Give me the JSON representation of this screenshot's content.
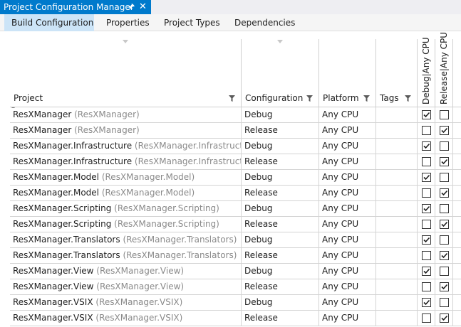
{
  "window": {
    "title": "Project Configuration Manager",
    "pin_icon": "pin-icon",
    "close_icon": "close-icon"
  },
  "tabs": [
    {
      "label": "Build Configuration",
      "active": true
    },
    {
      "label": "Properties",
      "active": false
    },
    {
      "label": "Project Types",
      "active": false
    },
    {
      "label": "Dependencies",
      "active": false
    }
  ],
  "columns": {
    "project": "Project",
    "configuration": "Configuration",
    "platform": "Platform",
    "tags": "Tags",
    "debug": "Debug|Any CPU",
    "release": "Release|Any CPU"
  },
  "rows": [
    {
      "project": "ResXManager",
      "sub": "(ResXManager)",
      "configuration": "Debug",
      "platform": "Any CPU",
      "debug": true,
      "release": false
    },
    {
      "project": "ResXManager",
      "sub": "(ResXManager)",
      "configuration": "Release",
      "platform": "Any CPU",
      "debug": false,
      "release": true
    },
    {
      "project": "ResXManager.Infrastructure",
      "sub": "(ResXManager.Infrastructure)",
      "configuration": "Debug",
      "platform": "Any CPU",
      "debug": true,
      "release": false
    },
    {
      "project": "ResXManager.Infrastructure",
      "sub": "(ResXManager.Infrastructure)",
      "configuration": "Release",
      "platform": "Any CPU",
      "debug": false,
      "release": true
    },
    {
      "project": "ResXManager.Model",
      "sub": "(ResXManager.Model)",
      "configuration": "Debug",
      "platform": "Any CPU",
      "debug": true,
      "release": false
    },
    {
      "project": "ResXManager.Model",
      "sub": "(ResXManager.Model)",
      "configuration": "Release",
      "platform": "Any CPU",
      "debug": false,
      "release": true
    },
    {
      "project": "ResXManager.Scripting",
      "sub": "(ResXManager.Scripting)",
      "configuration": "Debug",
      "platform": "Any CPU",
      "debug": true,
      "release": false
    },
    {
      "project": "ResXManager.Scripting",
      "sub": "(ResXManager.Scripting)",
      "configuration": "Release",
      "platform": "Any CPU",
      "debug": false,
      "release": true
    },
    {
      "project": "ResXManager.Translators",
      "sub": "(ResXManager.Translators)",
      "configuration": "Debug",
      "platform": "Any CPU",
      "debug": true,
      "release": false
    },
    {
      "project": "ResXManager.Translators",
      "sub": "(ResXManager.Translators)",
      "configuration": "Release",
      "platform": "Any CPU",
      "debug": false,
      "release": true
    },
    {
      "project": "ResXManager.View",
      "sub": "(ResXManager.View)",
      "configuration": "Debug",
      "platform": "Any CPU",
      "debug": true,
      "release": false
    },
    {
      "project": "ResXManager.View",
      "sub": "(ResXManager.View)",
      "configuration": "Release",
      "platform": "Any CPU",
      "debug": false,
      "release": true
    },
    {
      "project": "ResXManager.VSIX",
      "sub": "(ResXManager.VSIX)",
      "configuration": "Debug",
      "platform": "Any CPU",
      "debug": true,
      "release": false
    },
    {
      "project": "ResXManager.VSIX",
      "sub": "(ResXManager.VSIX)",
      "configuration": "Release",
      "platform": "Any CPU",
      "debug": false,
      "release": true
    }
  ],
  "colors": {
    "accent": "#007acc",
    "active_tab": "#cce4f7",
    "dim_text": "#8a8a8a"
  }
}
